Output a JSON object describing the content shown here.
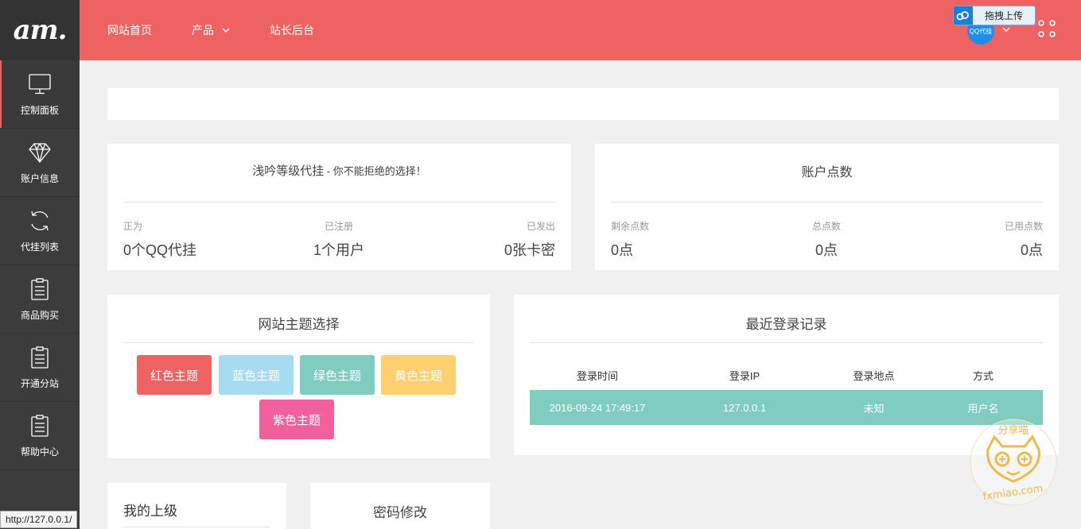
{
  "sidebar": {
    "logo": "am.",
    "items": [
      {
        "label": "控制面板",
        "icon": "monitor-icon"
      },
      {
        "label": "账户信息",
        "icon": "diamond-icon"
      },
      {
        "label": "代挂列表",
        "icon": "refresh-icon"
      },
      {
        "label": "商品购买",
        "icon": "clipboard-icon"
      },
      {
        "label": "开通分站",
        "icon": "clipboard-icon"
      },
      {
        "label": "帮助中心",
        "icon": "clipboard-icon"
      }
    ]
  },
  "header": {
    "nav": [
      "网站首页",
      "产品",
      "站长后台"
    ],
    "upload_label": "拖拽上传",
    "avatar_text": "QQ代挂",
    "accent": "#ef6262"
  },
  "site_card": {
    "title": "浅吟等级代挂",
    "subtitle": " - 你不能拒绝的选择！",
    "stats": [
      {
        "label": "正为",
        "value": "0个QQ代挂"
      },
      {
        "label": "已注册",
        "value": "1个用户"
      },
      {
        "label": "已发出",
        "value": "0张卡密"
      }
    ]
  },
  "points_card": {
    "title": "账户点数",
    "stats": [
      {
        "label": "剩余点数",
        "value": "0点"
      },
      {
        "label": "总点数",
        "value": "0点"
      },
      {
        "label": "已用点数",
        "value": "0点"
      }
    ]
  },
  "theme_card": {
    "title": "网站主题选择",
    "buttons": [
      {
        "label": "红色主题",
        "color": "#ef6262"
      },
      {
        "label": "蓝色主题",
        "color": "#a6dcf1"
      },
      {
        "label": "绿色主题",
        "color": "#7fcdbf"
      },
      {
        "label": "黄色主题",
        "color": "#fecf6f"
      },
      {
        "label": "紫色主题",
        "color": "#f2609b"
      }
    ]
  },
  "login_card": {
    "title": "最近登录记录",
    "columns": [
      "登录时间",
      "登录IP",
      "登录地点",
      "方式"
    ],
    "rows": [
      [
        "2016-09-24 17:49:17",
        "127.0.0.1",
        "未知",
        "用户名"
      ]
    ]
  },
  "superior_card": {
    "title": "我的上级"
  },
  "password_card": {
    "title": "密码修改"
  },
  "status_bar": {
    "url": "http://127.0.0.1/"
  },
  "watermark": {
    "top": "分享喵",
    "bottom": "fxmiao.com"
  }
}
